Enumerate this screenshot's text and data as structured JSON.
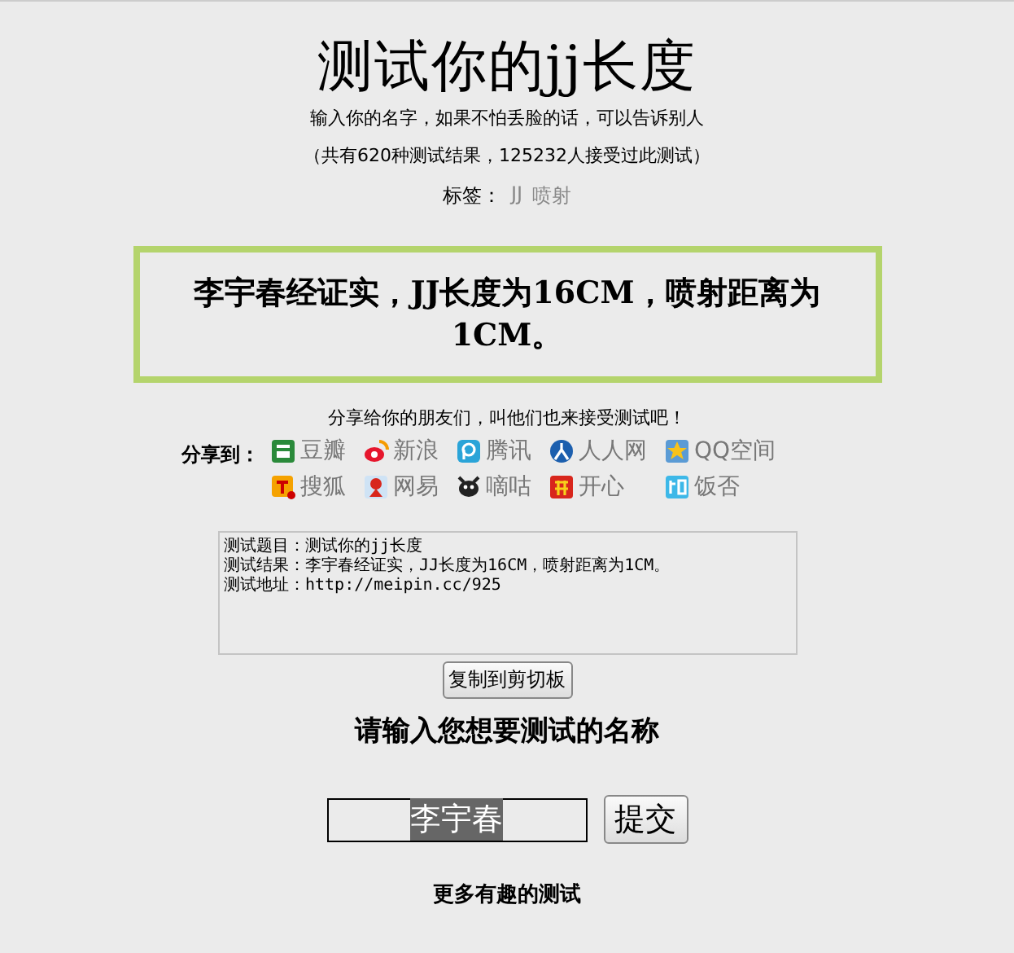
{
  "title": "测试你的jj长度",
  "subtitle": "输入你的名字，如果不怕丢脸的话，可以告诉别人",
  "stats": "（共有620种测试结果，125232人接受过此测试）",
  "tags": {
    "label": "标签：",
    "items": [
      "JJ",
      "喷射"
    ]
  },
  "result": "李宇春经证实，JJ长度为16CM，喷射距离为1CM。",
  "share": {
    "prompt": "分享给你的朋友们，叫他们也来接受测试吧！",
    "label": "分享到：",
    "items": [
      {
        "kind": "douban",
        "label": "豆瓣"
      },
      {
        "kind": "weibo",
        "label": "新浪"
      },
      {
        "kind": "tencent",
        "label": "腾讯"
      },
      {
        "kind": "renren",
        "label": "人人网"
      },
      {
        "kind": "qzone",
        "label": "QQ空间"
      },
      {
        "kind": "sohu",
        "label": "搜狐"
      },
      {
        "kind": "netease",
        "label": "网易"
      },
      {
        "kind": "digu",
        "label": "嘀咕"
      },
      {
        "kind": "kaixin",
        "label": "开心"
      },
      {
        "kind": "fanfou",
        "label": "饭否"
      }
    ]
  },
  "summary_lines": [
    "测试题目：测试你的jj长度",
    "测试结果：李宇春经证实，JJ长度为16CM，喷射距离为1CM。",
    "测试地址：http://meipin.cc/925"
  ],
  "copy_button": "复制到剪切板",
  "form": {
    "heading": "请输入您想要测试的名称",
    "value": "李宇春",
    "value_selected": true,
    "submit": "提交"
  },
  "more_heading": "更多有趣的测试"
}
